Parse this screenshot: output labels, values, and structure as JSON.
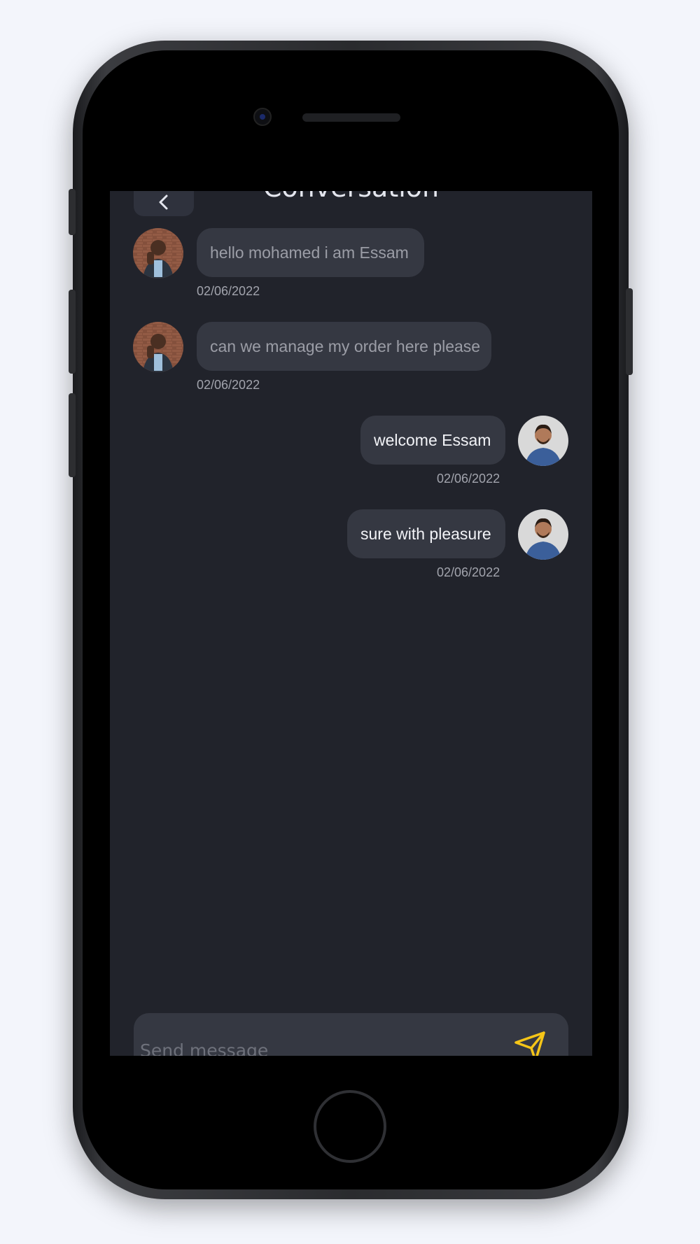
{
  "header": {
    "title": "Conversation"
  },
  "messages": [
    {
      "text": "hello mohamed i am Essam",
      "time": "02/06/2022",
      "direction": "incoming"
    },
    {
      "text": "can we manage my order here please",
      "time": "02/06/2022",
      "direction": "incoming"
    },
    {
      "text": "welcome Essam",
      "time": "02/06/2022",
      "direction": "outgoing"
    },
    {
      "text": "sure with pleasure",
      "time": "02/06/2022",
      "direction": "outgoing"
    }
  ],
  "composer": {
    "placeholder": "Send message"
  },
  "icons": {
    "back": "chevron-left-icon",
    "send": "send-icon"
  },
  "colors": {
    "screen_bg": "#21232b",
    "bubble": "#353842",
    "accent": "#f5c518"
  }
}
